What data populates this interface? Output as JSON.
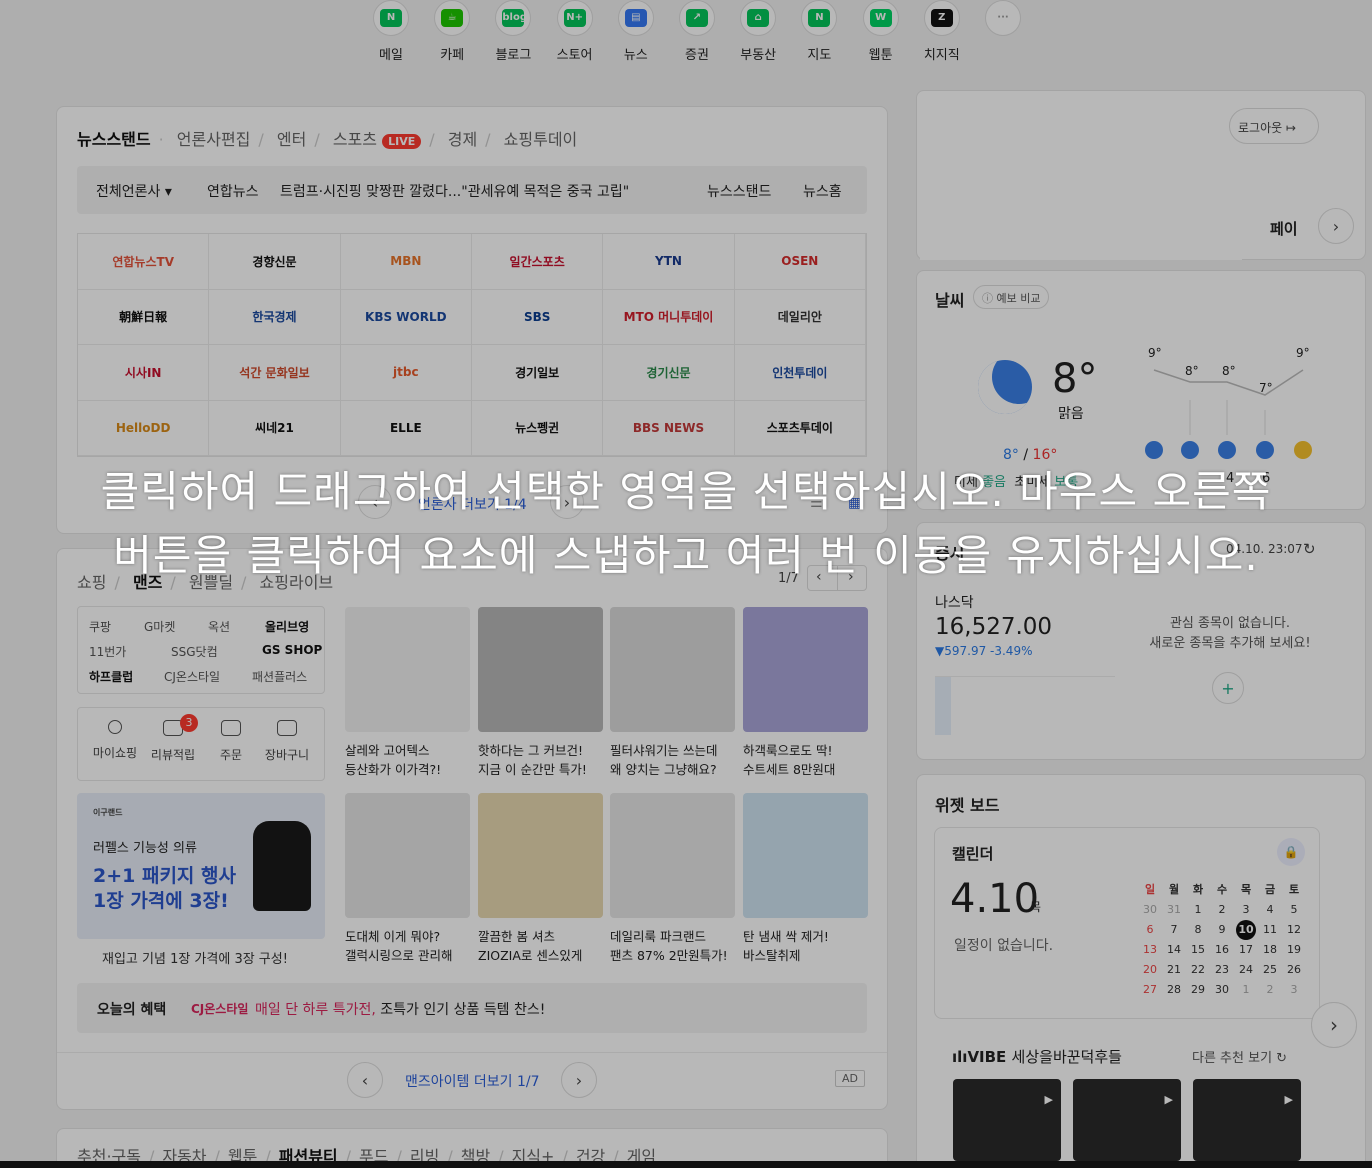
{
  "services": [
    {
      "label": "메일",
      "color": "#03c75a",
      "glyph": "N",
      "icon": "mail-icon"
    },
    {
      "label": "카페",
      "color": "#1ec800",
      "glyph": "☕",
      "icon": "cafe-icon"
    },
    {
      "label": "블로그",
      "color": "#03c75a",
      "glyph": "blog",
      "icon": "blog-icon"
    },
    {
      "label": "스토어",
      "color": "#03c75a",
      "glyph": "N+",
      "icon": "store-icon"
    },
    {
      "label": "뉴스",
      "color": "#3579f6",
      "glyph": "▤",
      "icon": "news-icon"
    },
    {
      "label": "증권",
      "color": "#03c75a",
      "glyph": "↗",
      "icon": "stock-icon"
    },
    {
      "label": "부동산",
      "color": "#03c75a",
      "glyph": "⌂",
      "icon": "realestate-icon"
    },
    {
      "label": "지도",
      "color": "#03c75a",
      "glyph": "N",
      "icon": "map-icon"
    },
    {
      "label": "웹툰",
      "color": "#00d564",
      "glyph": "W",
      "icon": "webtoon-icon"
    },
    {
      "label": "치지직",
      "color": "#111111",
      "glyph": "Z",
      "icon": "chzzk-icon"
    },
    {
      "label": "",
      "color": "#ffffff",
      "glyph": "···",
      "icon": "more-icon"
    }
  ],
  "newsstand": {
    "tabs": [
      "뉴스스탠드",
      "언론사편집",
      "엔터",
      "스포츠",
      "경제",
      "쇼핑투데이"
    ],
    "live": "LIVE",
    "all_press": "전체언론사",
    "press": "연합뉴스",
    "headline": "트럼프·시진핑 맞짱판 깔렸다...\"관세유예 목적은 중국 고립\"",
    "link1": "뉴스스탠드",
    "link2": "뉴스홈",
    "logos": [
      "연합뉴스TV",
      "경향신문",
      "MBN",
      "일간스포츠",
      "YTN",
      "OSEN",
      "朝鮮日報",
      "한국경제",
      "KBS WORLD",
      "SBS",
      "MTO 머니투데이",
      "데일리안",
      "시사IN",
      "석간 문화일보",
      "jtbc",
      "경기일보",
      "경기신문",
      "인천투데이",
      "HelloDD",
      "씨네21",
      "ELLE",
      "뉴스펭귄",
      "BBS NEWS",
      "스포츠투데이"
    ],
    "more": "언론사 더보기 1/4"
  },
  "shopping": {
    "tabs": [
      "쇼핑",
      "맨즈",
      "원쁠딜",
      "쇼핑라이브"
    ],
    "page": "1/7",
    "links": [
      "쿠팡",
      "G마켓",
      "옥션",
      "올리브영",
      "11번가",
      "SSG닷컴",
      "GS SHOP",
      "하프클럽",
      "CJ온스타일",
      "패션플러스"
    ],
    "my": [
      "마이쇼핑",
      "리뷰적립",
      "주문",
      "장바구니"
    ],
    "review_badge": "3",
    "promo_brand": "이구랜드",
    "promo_sub": "러펠스 기능성 의류",
    "promo_title1": "2+1 패키지 행사",
    "promo_title2": "1장 가격에 3장!",
    "promo_caption": "재입고 기념 1장 가격에 3장 구성!",
    "products": [
      {
        "line1": "살레와 고어텍스",
        "line2": "등산화가 이가격?!"
      },
      {
        "line1": "핫하다는 그 커브건!",
        "line2": "지금 이 순간만 특가!"
      },
      {
        "line1": "필터샤워기는 쓰는데",
        "line2": "왜 양치는 그냥해요?"
      },
      {
        "line1": "하객룩으로도 딱!",
        "line2": "수트세트 8만원대"
      },
      {
        "line1": "도대체 이게 뭐야?",
        "line2": "갤럭시링으로 관리해"
      },
      {
        "line1": "깔끔한 봄 셔츠",
        "line2": "ZIOZIA로 센스있게"
      },
      {
        "line1": "데일리룩 파크랜드",
        "line2": "팬츠 87% 2만원특가!"
      },
      {
        "line1": "탄 냄새 싹 제거!",
        "line2": "바스탈취제"
      }
    ],
    "benefit_label": "오늘의 혜택",
    "benefit_brand": "CJ온스타일",
    "benefit_text1": "매일 단 하루 특가전,",
    "benefit_text2": " 조특가 인기 상품 득템 찬스!",
    "more": "맨즈아이템 더보기 1/7",
    "ad": "AD"
  },
  "bottom_tabs": [
    "추천·구독",
    "자동차",
    "웹툰",
    "패션뷰티",
    "푸드",
    "리빙",
    "책방",
    "지식+",
    "건강",
    "게임"
  ],
  "account": {
    "logout": "로그아웃",
    "pay": "페이"
  },
  "weather": {
    "title": "날씨",
    "compare": "예보 비교",
    "temp": "8°",
    "desc": "맑음",
    "low": "8°",
    "high": "16°",
    "fine_dust_label": "미세",
    "fine_dust": "좋음",
    "ultra_dust_label": "초미세",
    "ultra_dust": "보통",
    "hourly": [
      "9°",
      "8°",
      "8°",
      "7°",
      "9°"
    ],
    "extra": [
      "4",
      "6"
    ]
  },
  "stock": {
    "title": "증시",
    "time": "04.10. 23:07",
    "index_name": "나스닥",
    "index_value": "16,527.00",
    "change": "▼597.97 -3.49%",
    "empty1": "관심 종목이 없습니다.",
    "empty2": "새로운 종목을 추가해 보세요!",
    "add": "+"
  },
  "widget": {
    "title": "위젯 보드",
    "cal_title": "캘린더",
    "date": "4.10",
    "weekday": "목",
    "no_event": "일정이 없습니다.",
    "days": [
      "일",
      "월",
      "화",
      "수",
      "목",
      "금",
      "토"
    ],
    "weeks": [
      [
        "30",
        "31",
        "1",
        "2",
        "3",
        "4",
        "5"
      ],
      [
        "6",
        "7",
        "8",
        "9",
        "10",
        "11",
        "12"
      ],
      [
        "13",
        "14",
        "15",
        "16",
        "17",
        "18",
        "19"
      ],
      [
        "20",
        "21",
        "22",
        "23",
        "24",
        "25",
        "26"
      ],
      [
        "27",
        "28",
        "29",
        "30",
        "1",
        "2",
        "3"
      ]
    ],
    "vibe_brand": "VIBE",
    "vibe_title": "세상을바꾼덕후들",
    "vibe_more": "다른 추천 보기"
  },
  "overlay": {
    "line1": "클릭하여 드래그하여 선택한 영역을 선택하십시오. 마우스 오른쪽",
    "line2": "버튼을 클릭하여 요소에 스냅하고 여러 번 이동을 유지하십시오."
  }
}
